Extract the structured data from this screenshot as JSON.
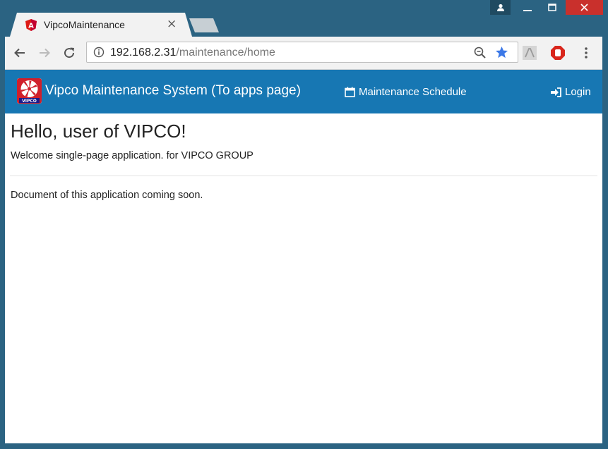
{
  "browser": {
    "tab_title": "VipcoMaintenance",
    "url_host": "192.168.2.31",
    "url_path": "/maintenance/home"
  },
  "navbar": {
    "brand": "Vipco Maintenance System (To apps page)",
    "logo_text": "VIPCO",
    "schedule_link": "Maintenance Schedule",
    "login_link": "Login"
  },
  "content": {
    "heading": "Hello, user of VIPCO!",
    "welcome": "Welcome single-page application. for VIPCO GROUP",
    "doc_note": "Document of this application coming soon."
  },
  "colors": {
    "window_frame": "#2b6382",
    "navbar": "#1777b3",
    "close_button": "#c9302c"
  },
  "icons": {
    "favicon": "angular-icon",
    "calendar": "calendar-icon",
    "login": "sign-in-icon",
    "star": "star-icon"
  }
}
